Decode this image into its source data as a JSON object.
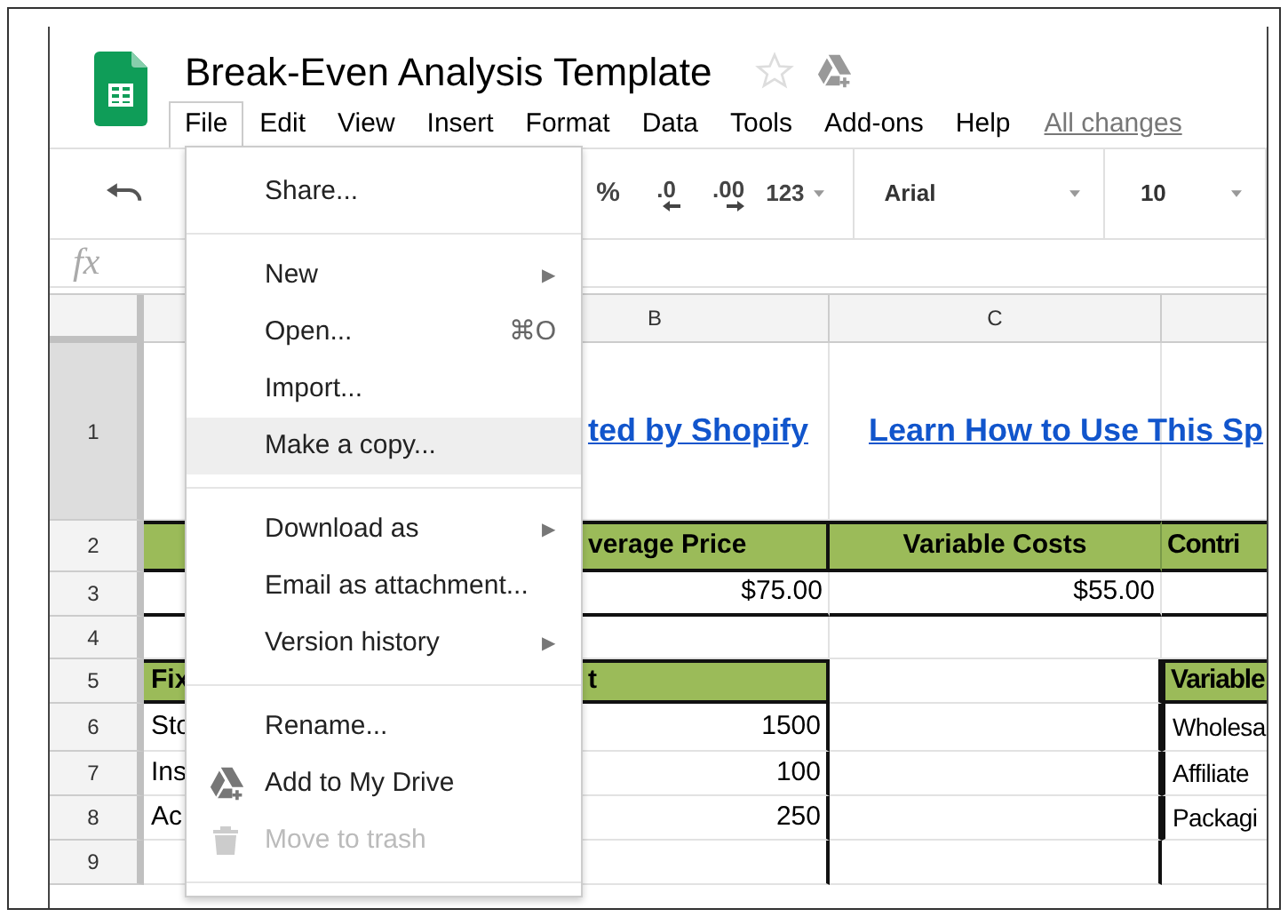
{
  "document": {
    "title": "Break-Even Analysis Template",
    "save_status": "All changes"
  },
  "menubar": [
    {
      "label": "File",
      "selected": true
    },
    {
      "label": "Edit",
      "selected": false
    },
    {
      "label": "View",
      "selected": false
    },
    {
      "label": "Insert",
      "selected": false
    },
    {
      "label": "Format",
      "selected": false
    },
    {
      "label": "Data",
      "selected": false
    },
    {
      "label": "Tools",
      "selected": false
    },
    {
      "label": "Add-ons",
      "selected": false
    },
    {
      "label": "Help",
      "selected": false
    }
  ],
  "toolbar": {
    "percent": "%",
    "decrease_decimals": ".0",
    "increase_decimals": ".00",
    "number_format": "123",
    "font": "Arial",
    "font_size": "10"
  },
  "formula_bar": {
    "label": "fx"
  },
  "column_headers": [
    "B",
    "C"
  ],
  "rows": [
    {
      "number": "1",
      "selected": true,
      "cells": [
        null,
        {
          "kind": "link",
          "text": "ted by Shopify"
        },
        {
          "kind": "link",
          "text": "Learn How to Use This Sp"
        },
        null
      ]
    },
    {
      "number": "2",
      "selected": false,
      "cells": [
        {
          "kind": "header"
        },
        {
          "kind": "header",
          "text": "verage Price"
        },
        {
          "kind": "header",
          "text": "Variable Costs"
        },
        {
          "kind": "header",
          "text": "Contri"
        }
      ]
    },
    {
      "number": "3",
      "selected": false,
      "cells": [
        null,
        {
          "kind": "value",
          "text": "$75.00"
        },
        {
          "kind": "value",
          "text": "$55.00"
        },
        null
      ]
    },
    {
      "number": "4",
      "selected": false,
      "cells": [
        null,
        null,
        null,
        null
      ]
    },
    {
      "number": "5",
      "selected": false,
      "cells": [
        {
          "kind": "header",
          "text": "Fix"
        },
        {
          "kind": "header",
          "text": "t"
        },
        null,
        {
          "kind": "header",
          "text": "Variable"
        }
      ]
    },
    {
      "number": "6",
      "selected": false,
      "cells": [
        {
          "kind": "text",
          "text": "Sto"
        },
        {
          "kind": "value",
          "text": "1500"
        },
        null,
        {
          "kind": "text",
          "text": "Wholesa"
        }
      ]
    },
    {
      "number": "7",
      "selected": false,
      "cells": [
        {
          "kind": "text",
          "text": "Ins"
        },
        {
          "kind": "value",
          "text": "100"
        },
        null,
        {
          "kind": "text",
          "text": "Affiliate"
        }
      ]
    },
    {
      "number": "8",
      "selected": false,
      "cells": [
        {
          "kind": "text",
          "text": "Ac"
        },
        {
          "kind": "value",
          "text": "250"
        },
        null,
        {
          "kind": "text",
          "text": "Packagi"
        }
      ]
    },
    {
      "number": "9",
      "selected": false,
      "cells": [
        null,
        null,
        null,
        null
      ]
    }
  ],
  "file_menu": [
    {
      "kind": "item",
      "label": "Share...",
      "selected": false,
      "disabled": false
    },
    {
      "kind": "divider"
    },
    {
      "kind": "item",
      "label": "New",
      "arrow": "▶",
      "selected": false,
      "disabled": false
    },
    {
      "kind": "item",
      "label": "Open...",
      "shortcut": "⌘O",
      "selected": false,
      "disabled": false
    },
    {
      "kind": "item",
      "label": "Import...",
      "selected": false,
      "disabled": false
    },
    {
      "kind": "item",
      "label": "Make a copy...",
      "selected": true,
      "disabled": false
    },
    {
      "kind": "divider"
    },
    {
      "kind": "item",
      "label": "Download as",
      "arrow": "▶",
      "selected": false,
      "disabled": false
    },
    {
      "kind": "item",
      "label": "Email as attachment...",
      "selected": false,
      "disabled": false
    },
    {
      "kind": "item",
      "label": "Version history",
      "arrow": "▶",
      "selected": false,
      "disabled": false
    },
    {
      "kind": "divider"
    },
    {
      "kind": "item",
      "label": "Rename...",
      "selected": false,
      "disabled": false
    },
    {
      "kind": "drive",
      "label": "Add to My Drive",
      "selected": false,
      "disabled": false
    },
    {
      "kind": "trash",
      "label": "Move to trash",
      "selected": false,
      "disabled": true
    },
    {
      "kind": "divider"
    }
  ]
}
